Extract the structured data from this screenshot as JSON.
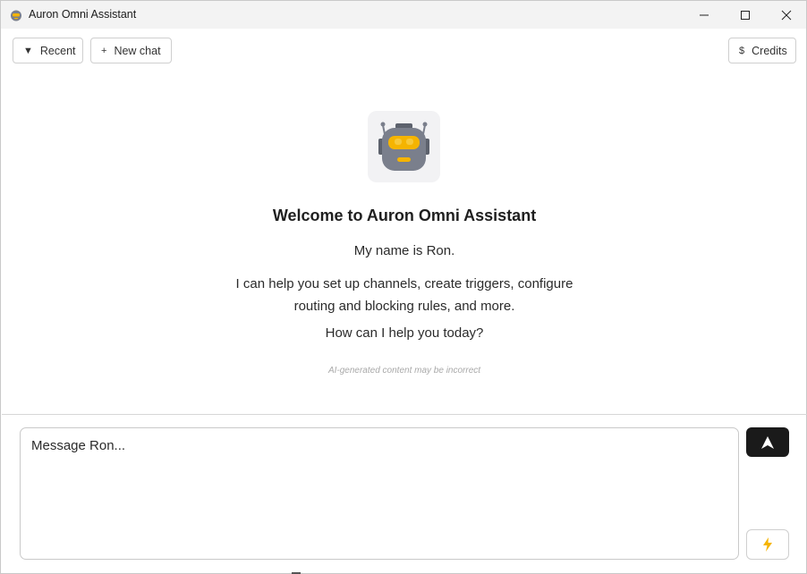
{
  "window": {
    "title": "Auron Omni Assistant",
    "icons": [
      "app-robot-icon",
      "minimize-icon",
      "maximize-icon",
      "close-icon"
    ]
  },
  "toolbar": {
    "recent_label": "Recent",
    "recent_glyph": "▼",
    "new_chat_label": "New chat",
    "new_chat_glyph": "+",
    "credits_label": "Credits",
    "credits_glyph": "$"
  },
  "welcome": {
    "avatar_icon": "robot-icon",
    "title": "Welcome to Auron Omni Assistant",
    "intro_name": "My name is Ron.",
    "intro_help": "I can help you set up channels, create triggers, configure routing and blocking rules, and more.",
    "intro_question": "How can I help you today?",
    "disclaimer": "AI-generated content may be incorrect"
  },
  "composer": {
    "placeholder": "Message Ron...",
    "send_icon": "send-arrow-icon",
    "quick_icon": "lightning-icon"
  },
  "colors": {
    "send_button_bg": "#1a1a1a",
    "robot_eye": "#f5b400",
    "robot_body": "#7a7f8c",
    "lightning": "#f5b400"
  }
}
